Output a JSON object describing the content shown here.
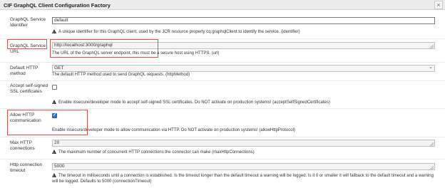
{
  "dialog": {
    "title": "CIF GraphQL Client Configuration Factory",
    "close_glyph": "×"
  },
  "fields": {
    "identifier": {
      "label": "GraphQL Service Identifier",
      "value": "default",
      "description": "A unique identifier for this GraphQL client, used by the JCR resource property cq:graphqlClient to identify the service. (identifier)"
    },
    "url": {
      "label": "GraphQL Service URL",
      "value": "http://localhost:3000/graphql",
      "description": "The URL of the GraphQL server endpoint, this must be a secure host using HTTPS. (url)"
    },
    "http_method": {
      "label": "Default HTTP method",
      "value": "GET",
      "chevron": "⌄",
      "description": "The default HTTP method used to send GraphQL requests. (httpMethod)"
    },
    "self_signed": {
      "label": "Accept self-signed SSL certificates",
      "checked": false,
      "description": "Enable insecure/developer mode to accept self-signed SSL certificates. Do NOT activate on production systems! (acceptSelfSignedCertificates)"
    },
    "allow_http": {
      "label": "Allow HTTP communication",
      "checked": true,
      "description": "Enable insecure/developer mode to allow communication via HTTP. Do NOT activate on production systems! (allowHttpProtocol)"
    },
    "max_connections": {
      "label": "Max HTTP connections",
      "value": "20",
      "description": "The maximum number of concurrent HTTP connections the connector can make (maxHttpConnections)"
    },
    "timeout": {
      "label": "Http connection timeout",
      "value": "5000",
      "description": "The timeout in milliseconds until a connection is established. Is the timeout longer than the default timeout a warning will be logged. Is it 0 or smaller it will fallback to the default timeout and a warning will be logged. Defaults to 5000 (connectionTimeout)"
    }
  },
  "icons": {
    "warning": "warning-icon",
    "warning_glyph": "!"
  },
  "colors": {
    "highlight": "#d9534f",
    "checkbox_checked": "#2f6fd6"
  }
}
